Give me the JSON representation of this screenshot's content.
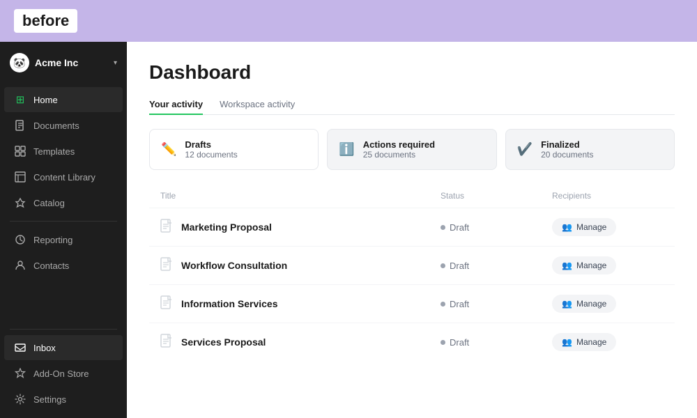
{
  "topbar": {
    "logo_text": "before"
  },
  "sidebar": {
    "company_name": "Acme Inc",
    "chevron": "›",
    "logo_emoji": "🐼",
    "nav_items": [
      {
        "id": "home",
        "label": "Home",
        "icon": "⊞",
        "active": true
      },
      {
        "id": "documents",
        "label": "Documents",
        "icon": "📄",
        "active": false
      },
      {
        "id": "templates",
        "label": "Templates",
        "icon": "⊟",
        "active": false
      },
      {
        "id": "content-library",
        "label": "Content Library",
        "icon": "📋",
        "active": false
      },
      {
        "id": "catalog",
        "label": "Catalog",
        "icon": "🏷",
        "active": false
      }
    ],
    "nav_items_bottom": [
      {
        "id": "reporting",
        "label": "Reporting",
        "icon": "🕐",
        "active": false
      },
      {
        "id": "contacts",
        "label": "Contacts",
        "icon": "👤",
        "active": false
      }
    ],
    "nav_items_footer": [
      {
        "id": "inbox",
        "label": "Inbox",
        "icon": "📥",
        "active": true
      },
      {
        "id": "addon-store",
        "label": "Add-On Store",
        "icon": "⬡",
        "active": false
      },
      {
        "id": "settings",
        "label": "Settings",
        "icon": "⚙",
        "active": false
      }
    ]
  },
  "content": {
    "page_title": "Dashboard",
    "tabs": [
      {
        "id": "your-activity",
        "label": "Your activity",
        "active": true
      },
      {
        "id": "workspace-activity",
        "label": "Workspace activity",
        "active": false
      }
    ],
    "stats": [
      {
        "id": "drafts",
        "label": "Drafts",
        "count": "12 documents",
        "icon": "✏",
        "type": "drafts"
      },
      {
        "id": "actions-required",
        "label": "Actions required",
        "count": "25 documents",
        "icon": "ℹ",
        "type": "actions"
      },
      {
        "id": "finalized",
        "label": "Finalized",
        "count": "20 documents",
        "icon": "✔",
        "type": "finalized"
      }
    ],
    "table_headers": {
      "title": "Title",
      "status": "Status",
      "recipients": "Recipients"
    },
    "documents": [
      {
        "id": 1,
        "name": "Marketing Proposal",
        "status": "Draft",
        "btn_label": "Manage"
      },
      {
        "id": 2,
        "name": "Workflow Consultation",
        "status": "Draft",
        "btn_label": "Manage"
      },
      {
        "id": 3,
        "name": "Information Services",
        "status": "Draft",
        "btn_label": "Manage"
      },
      {
        "id": 4,
        "name": "Services Proposal",
        "status": "Draft",
        "btn_label": "Manage"
      }
    ],
    "manage_icon": "👥"
  }
}
